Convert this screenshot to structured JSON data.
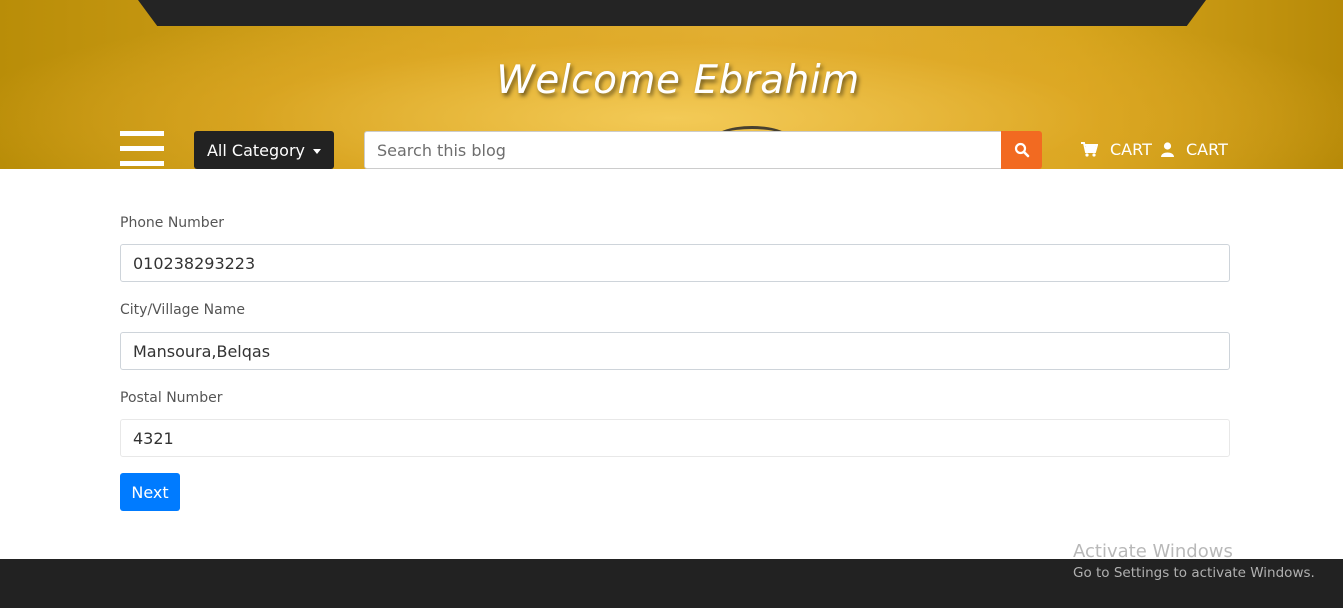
{
  "header": {
    "welcome_text": "Welcome Ebrahim",
    "category_button": "All Category",
    "search_placeholder": "Search this blog",
    "cart_label_1": "CART",
    "cart_label_2": "CART"
  },
  "form": {
    "phone_label": "Phone Number",
    "phone_value": "010238293223",
    "city_label": "City/Village Name",
    "city_value": "Mansoura,Belqas",
    "postal_label": "Postal Number",
    "postal_value": "4321",
    "next_button": "Next"
  },
  "watermark": {
    "title": "Activate Windows",
    "subtitle": "Go to Settings to activate Windows."
  },
  "colors": {
    "accent_orange": "#f26a21",
    "primary_blue": "#007bff",
    "dark": "#222222",
    "hero_gold": "#d8a620"
  },
  "icons": [
    "hamburger-menu-icon",
    "caret-down-icon",
    "search-icon",
    "cart-icon",
    "user-icon"
  ]
}
